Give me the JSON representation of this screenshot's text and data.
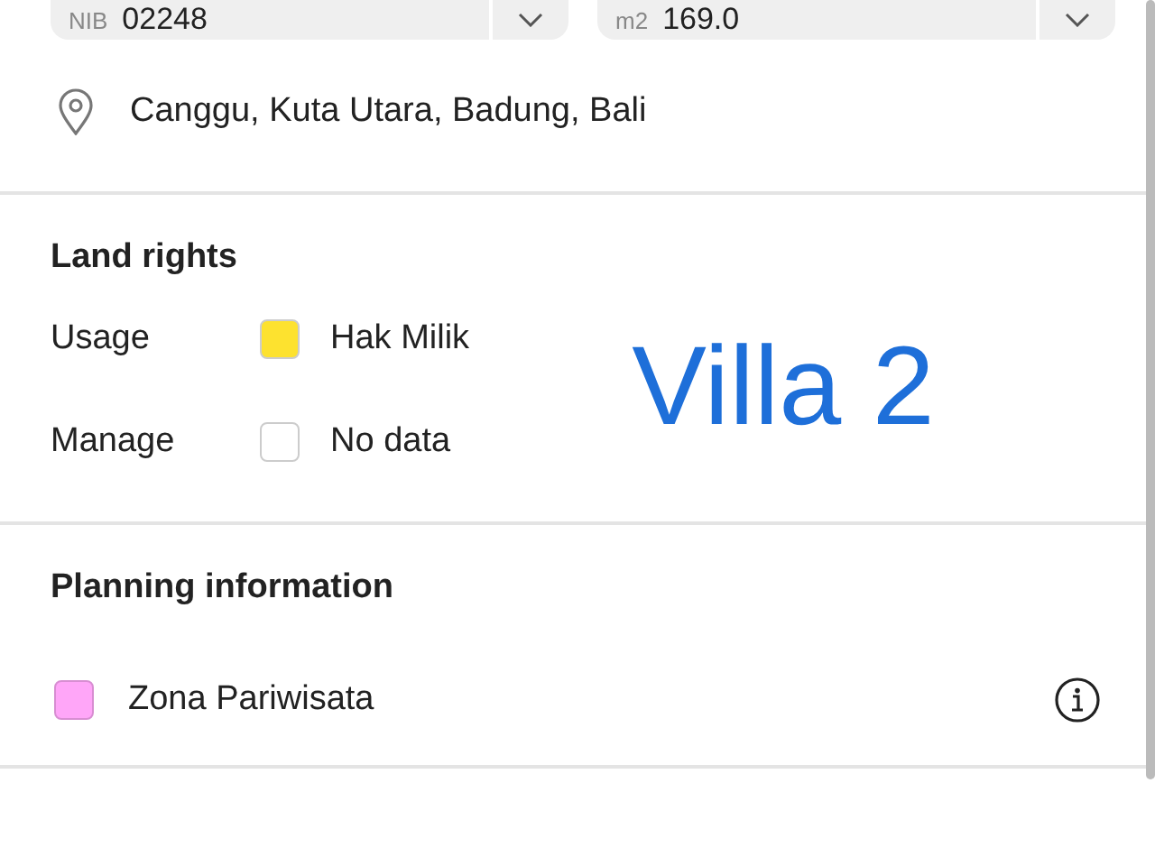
{
  "fields": [
    {
      "label": "NIB",
      "value": "02248"
    },
    {
      "label": "m2",
      "value": "169.0"
    }
  ],
  "location": "Canggu, Kuta Utara, Badung, Bali",
  "land_rights": {
    "title": "Land rights",
    "rows": [
      {
        "label": "Usage",
        "value": "Hak Milik",
        "color": "#fde22f"
      },
      {
        "label": "Manage",
        "value": "No data",
        "color": "#ffffff"
      }
    ]
  },
  "overlay_text": "Villa 2",
  "planning": {
    "title": "Planning information",
    "zones": [
      {
        "label": "Zona Pariwisata",
        "color": "#ffa6f8"
      }
    ]
  }
}
